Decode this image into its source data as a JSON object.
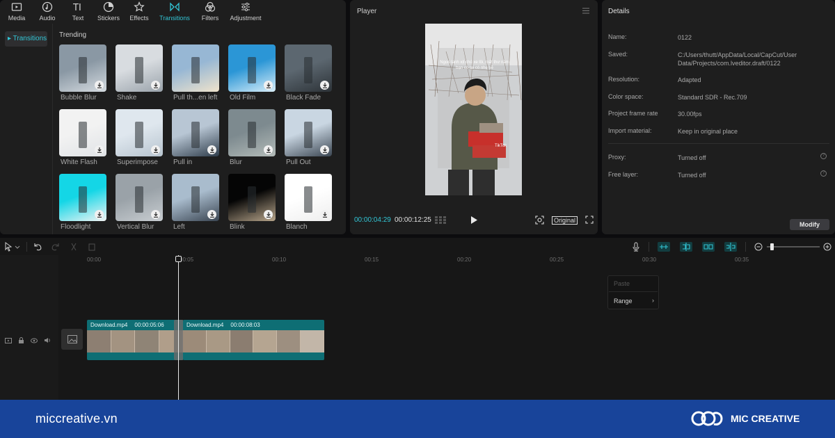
{
  "toolbar": [
    {
      "label": "Media",
      "icon": "media-icon"
    },
    {
      "label": "Audio",
      "icon": "audio-icon"
    },
    {
      "label": "Text",
      "icon": "text-icon"
    },
    {
      "label": "Stickers",
      "icon": "stickers-icon"
    },
    {
      "label": "Effects",
      "icon": "effects-icon"
    },
    {
      "label": "Transitions",
      "icon": "transitions-icon",
      "active": true
    },
    {
      "label": "Filters",
      "icon": "filters-icon"
    },
    {
      "label": "Adjustment",
      "icon": "adjustment-icon"
    }
  ],
  "sidebar": {
    "selected": "Transitions"
  },
  "library": {
    "section_title": "Trending",
    "items": [
      {
        "name": "Bubble Blur",
        "download": true
      },
      {
        "name": "Shake",
        "download": true
      },
      {
        "name": "Pull th...en left",
        "download": false
      },
      {
        "name": "Old Film",
        "download": true
      },
      {
        "name": "Black Fade",
        "download": true
      },
      {
        "name": "White Flash",
        "download": true
      },
      {
        "name": "Superimpose",
        "download": true
      },
      {
        "name": "Pull in",
        "download": true
      },
      {
        "name": "Blur",
        "download": true
      },
      {
        "name": "Pull Out",
        "download": true
      },
      {
        "name": "Floodlight",
        "download": true
      },
      {
        "name": "Vertical Blur",
        "download": true
      },
      {
        "name": "Left",
        "download": true
      },
      {
        "name": "Blink",
        "download": true
      },
      {
        "name": "Blanch",
        "download": true
      }
    ]
  },
  "player": {
    "title": "Player",
    "current_time": "00:00:04:29",
    "total_time": "00:00:12:25",
    "ratio_label": "Original",
    "overlay_caption": "Ngon lành xịt chú xe lôi, mất thư năm bạn có tại có nhẹ sẽ",
    "overlay_badge": "TikTok"
  },
  "details": {
    "title": "Details",
    "rows": [
      {
        "label": "Name:",
        "value": "0122"
      },
      {
        "label": "Saved:",
        "value": "C:/Users/thutt/AppData/Local/CapCut/User Data/Projects/com.lveditor.draft/0122"
      },
      {
        "label": "Resolution:",
        "value": "Adapted"
      },
      {
        "label": "Color space:",
        "value": "Standard SDR - Rec.709"
      },
      {
        "label": "Project frame rate",
        "value": "30.00fps"
      },
      {
        "label": "Import material:",
        "value": "Keep in original place"
      }
    ],
    "extra_rows": [
      {
        "label": "Proxy:",
        "value": "Turned off"
      },
      {
        "label": "Free layer:",
        "value": "Turned off"
      }
    ],
    "modify_label": "Modify"
  },
  "timeline": {
    "ticks": [
      "00:00",
      "00:05",
      "00:10",
      "00:15",
      "00:20",
      "00:25",
      "00:30",
      "00:35"
    ],
    "clips": [
      {
        "name": "Download.mp4",
        "duration": "00:00:05:06"
      },
      {
        "name": "Download.mp4",
        "duration": "00:00:08:03"
      }
    ],
    "context_menu": {
      "paste": "Paste",
      "range": "Range"
    }
  },
  "footer": {
    "site": "miccreative.vn",
    "brand": "MIC CREATIVE"
  },
  "colors": {
    "accent": "#32c6d6",
    "clip": "#0e6e74",
    "footer": "#18449a"
  }
}
